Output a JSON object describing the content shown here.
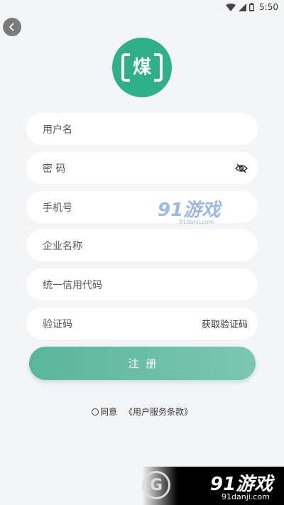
{
  "status_bar": {
    "time": "5:50",
    "icons": [
      "wifi-icon",
      "signal-icon",
      "battery-icon"
    ]
  },
  "logo": {
    "char": "煤"
  },
  "form": {
    "username_placeholder": "用户名",
    "password_placeholder": "密 码",
    "phone_placeholder": "手机号",
    "company_placeholder": "企业名称",
    "credit_code_placeholder": "统一信用代码",
    "captcha_placeholder": "验证码",
    "get_captcha_label": "获取验证码"
  },
  "register_label": "注册",
  "agreement": {
    "agree_text": "同意",
    "terms_link": "《用户服务条款》"
  },
  "watermark": {
    "middle_brand": "91游戏",
    "middle_domain": "91danji.com",
    "bottom_brand": "91游戏",
    "bottom_domain": "91danji.com"
  },
  "colors": {
    "accent": "#2eb08a",
    "button": "#5ab59b",
    "background": "#f4f5f6"
  }
}
